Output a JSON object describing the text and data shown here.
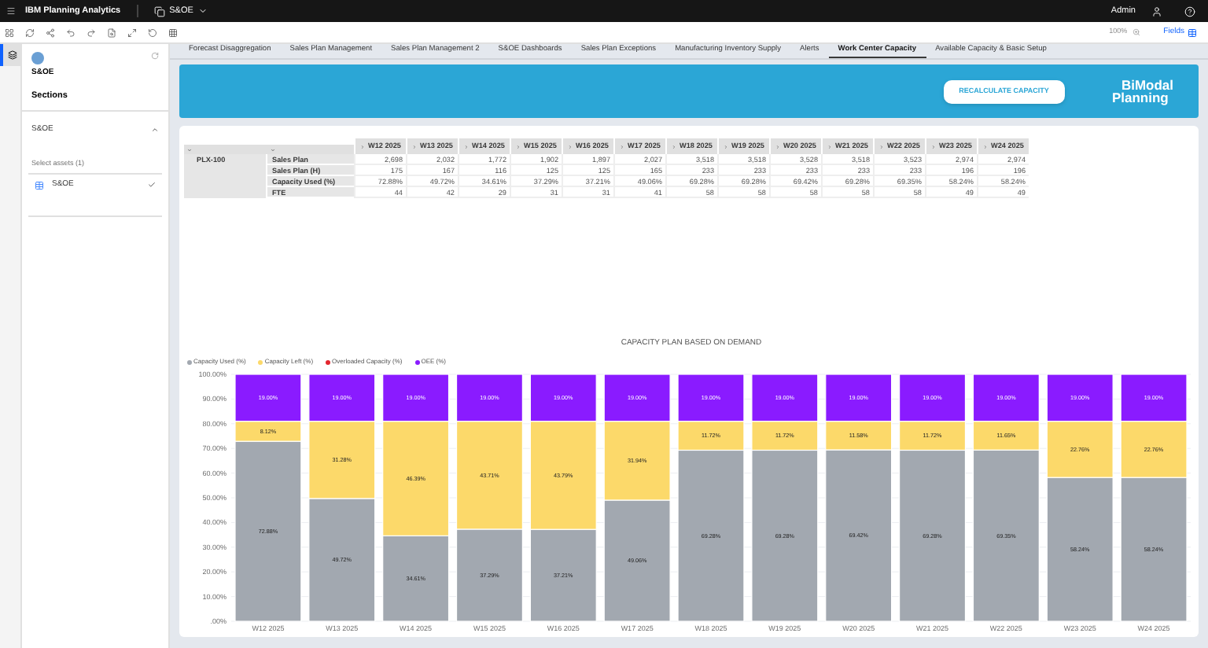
{
  "top_bar": {
    "app_name": "IBM Planning Analytics",
    "workspace": "S&OE",
    "user": "Admin"
  },
  "toolbar": {
    "zoom": "100%",
    "fields_label": "Fields"
  },
  "sidebar": {
    "title": "S&OE",
    "heading": "Sections",
    "section": {
      "label": "S&OE",
      "expanded": true
    },
    "assets_label": "Select assets (1)",
    "assets": [
      {
        "label": "S&OE",
        "selected": true
      }
    ]
  },
  "tabs": [
    {
      "label": "Forecast Disaggregation",
      "selected": false
    },
    {
      "label": "Sales Plan Management",
      "selected": false
    },
    {
      "label": "Sales Plan Management 2",
      "selected": false
    },
    {
      "label": "S&OE Dashboards",
      "selected": false
    },
    {
      "label": "Sales Plan Exceptions",
      "selected": false
    },
    {
      "label": "Manufacturing Inventory Supply",
      "selected": false
    },
    {
      "label": "Alerts",
      "selected": false
    },
    {
      "label": "Work Center Capacity",
      "selected": true
    },
    {
      "label": "Available Capacity & Basic Setup",
      "selected": false
    }
  ],
  "banner": {
    "button": "RECALCULATE CAPACITY",
    "logo_line1": "BiModal",
    "logo_line2": "Planning"
  },
  "table": {
    "columns": [
      "W12 2025",
      "W13 2025",
      "W14 2025",
      "W15 2025",
      "W16 2025",
      "W17 2025",
      "W18 2025",
      "W19 2025",
      "W20 2025",
      "W21 2025",
      "W22 2025",
      "W23 2025",
      "W24 2025"
    ],
    "row_group": "PLX-100",
    "rows": [
      {
        "label": "Sales Plan",
        "cells": [
          "2,698",
          "2,032",
          "1,772",
          "1,902",
          "1,897",
          "2,027",
          "3,518",
          "3,518",
          "3,528",
          "3,518",
          "3,523",
          "2,974",
          "2,974"
        ]
      },
      {
        "label": "Sales Plan (H)",
        "cells": [
          "175",
          "167",
          "116",
          "125",
          "125",
          "165",
          "233",
          "233",
          "233",
          "233",
          "233",
          "196",
          "196"
        ]
      },
      {
        "label": "Capacity Used (%)",
        "cells": [
          "72.88%",
          "49.72%",
          "34.61%",
          "37.29%",
          "37.21%",
          "49.06%",
          "69.28%",
          "69.28%",
          "69.42%",
          "69.28%",
          "69.35%",
          "58.24%",
          "58.24%"
        ]
      },
      {
        "label": "FTE",
        "cells": [
          "44",
          "42",
          "29",
          "31",
          "31",
          "41",
          "58",
          "58",
          "58",
          "58",
          "58",
          "49",
          "49"
        ]
      }
    ]
  },
  "chart": {
    "chart_data": {
      "type": "bar",
      "title": "CAPACITY PLAN BASED ON DEMAND",
      "stacked": true,
      "grid": true,
      "categories": [
        "W12 2025",
        "W13 2025",
        "W14 2025",
        "W15 2025",
        "W16 2025",
        "W17 2025",
        "W18 2025",
        "W19 2025",
        "W20 2025",
        "W21 2025",
        "W22 2025",
        "W23 2025",
        "W24 2025"
      ],
      "series": [
        {
          "name": "Capacity Used (%)",
          "color": "#a2a8b0",
          "values": [
            72.88,
            49.72,
            34.61,
            37.29,
            37.21,
            49.06,
            69.28,
            69.28,
            69.42,
            69.28,
            69.35,
            58.24,
            58.24
          ],
          "value_labels": [
            "72.88%",
            "49.72%",
            "34.61%",
            "37.29%",
            "37.21%",
            "49.06%",
            "69.28%",
            "69.28%",
            "69.42%",
            "69.28%",
            "69.35%",
            "58.24%",
            "58.24%"
          ]
        },
        {
          "name": "Capacity Left (%)",
          "color": "#fcd96a",
          "values": [
            8.12,
            31.28,
            46.39,
            43.71,
            43.79,
            31.94,
            11.72,
            11.72,
            11.58,
            11.72,
            11.65,
            22.76,
            22.76
          ],
          "value_labels": [
            "8.12%",
            "31.28%",
            "46.39%",
            "43.71%",
            "43.79%",
            "31.94%",
            "11.72%",
            "11.72%",
            "11.58%",
            "11.72%",
            "11.65%",
            "22.76%",
            "22.76%"
          ]
        },
        {
          "name": "Overloaded Capacity (%)",
          "color": "#e3262e",
          "values": [
            0,
            0,
            0,
            0,
            0,
            0,
            0,
            0,
            0,
            0,
            0,
            0,
            0
          ],
          "value_labels": [
            null,
            null,
            null,
            null,
            null,
            null,
            null,
            null,
            null,
            null,
            null,
            null,
            null
          ]
        },
        {
          "name": "OEE (%)",
          "color": "#8a1bff",
          "values": [
            19,
            19,
            19,
            19,
            19,
            19,
            19,
            19,
            19,
            19,
            19,
            19,
            19
          ],
          "value_labels": [
            "19.00%",
            "19.00%",
            "19.00%",
            "19.00%",
            "19.00%",
            "19.00%",
            "19.00%",
            "19.00%",
            "19.00%",
            "19.00%",
            "19.00%",
            "19.00%",
            "19.00%"
          ]
        }
      ],
      "ylim": [
        0,
        100
      ],
      "yticks": [
        {
          "value": 0,
          "label": ".00%"
        },
        {
          "value": 10,
          "label": "10.00%"
        },
        {
          "value": 20,
          "label": "20.00%"
        },
        {
          "value": 30,
          "label": "30.00%"
        },
        {
          "value": 40,
          "label": "40.00%"
        },
        {
          "value": 50,
          "label": "50.00%"
        },
        {
          "value": 60,
          "label": "60.00%"
        },
        {
          "value": 70,
          "label": "70.00%"
        },
        {
          "value": 80,
          "label": "80.00%"
        },
        {
          "value": 90,
          "label": "90.00%"
        },
        {
          "value": 100,
          "label": "100.00%"
        }
      ]
    }
  }
}
